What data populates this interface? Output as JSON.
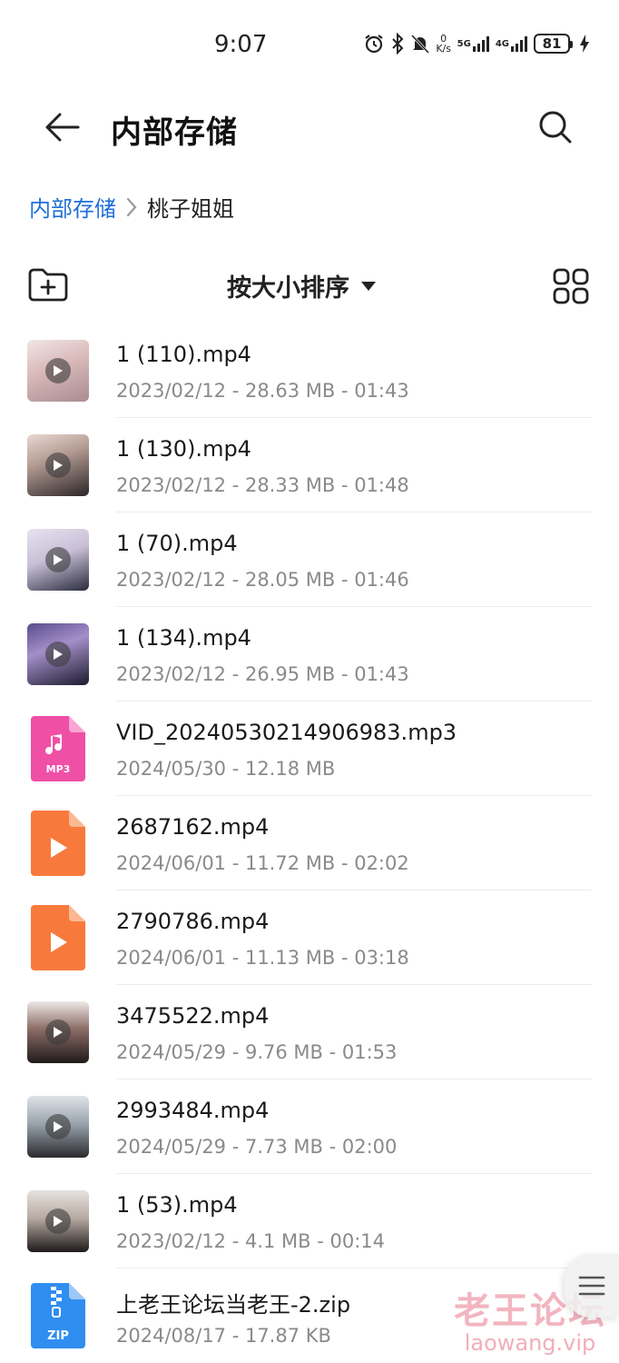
{
  "status_bar": {
    "time": "9:07",
    "speed_value": "0",
    "speed_unit": "K/s",
    "net1": "5G",
    "net2": "4G",
    "battery": "81"
  },
  "header": {
    "title": "内部存储"
  },
  "breadcrumb": {
    "root": "内部存储",
    "current": "桃子姐姐"
  },
  "toolbar": {
    "sort_label": "按大小排序"
  },
  "files": [
    {
      "name": "1 (110).mp4",
      "meta": "2023/02/12 - 28.63 MB - 01:43",
      "type": "video-thumb"
    },
    {
      "name": "1 (130).mp4",
      "meta": "2023/02/12 - 28.33 MB - 01:48",
      "type": "video-thumb"
    },
    {
      "name": "1 (70).mp4",
      "meta": "2023/02/12 - 28.05 MB - 01:46",
      "type": "video-thumb"
    },
    {
      "name": "1 (134).mp4",
      "meta": "2023/02/12 - 26.95 MB - 01:43",
      "type": "video-thumb"
    },
    {
      "name": "VID_20240530214906983.mp3",
      "meta": "2024/05/30 - 12.18 MB",
      "type": "mp3",
      "icon_label": "MP3"
    },
    {
      "name": "2687162.mp4",
      "meta": "2024/06/01 - 11.72 MB - 02:02",
      "type": "video-icon"
    },
    {
      "name": "2790786.mp4",
      "meta": "2024/06/01 - 11.13 MB - 03:18",
      "type": "video-icon"
    },
    {
      "name": "3475522.mp4",
      "meta": "2024/05/29 - 9.76 MB - 01:53",
      "type": "video-thumb"
    },
    {
      "name": "2993484.mp4",
      "meta": "2024/05/29 - 7.73 MB - 02:00",
      "type": "video-thumb"
    },
    {
      "name": "1 (53).mp4",
      "meta": "2023/02/12 - 4.1 MB - 00:14",
      "type": "video-thumb"
    },
    {
      "name": "上老王论坛当老王-2.zip",
      "meta": "2024/08/17 - 17.87 KB",
      "type": "zip",
      "icon_label": "ZIP"
    }
  ],
  "watermark": {
    "cn": "老王论坛",
    "en": "laowang.vip"
  },
  "colors": {
    "accent_blue": "#1e6fd8",
    "mp3_pink": "#f04fa6",
    "video_orange": "#f77a3c",
    "zip_blue": "#2f8ef0"
  }
}
